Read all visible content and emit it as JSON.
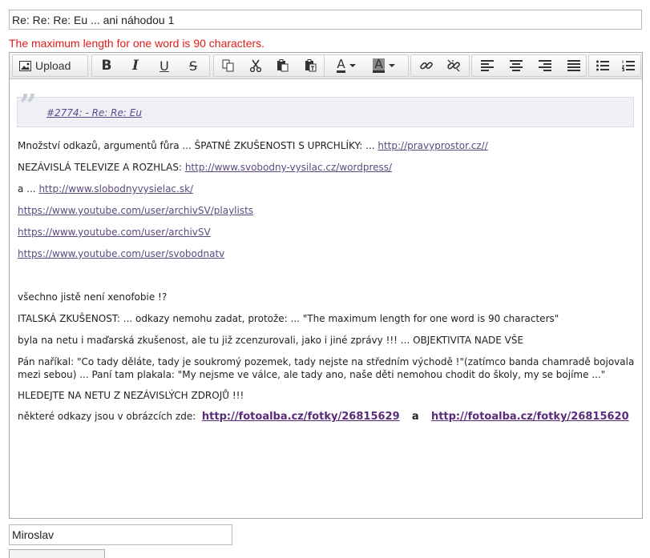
{
  "subject": {
    "value": "Re: Re: Re: Eu ... ani náhodou 1"
  },
  "error": {
    "text": "The maximum length for one word is 90 characters."
  },
  "toolbar": {
    "upload_label": "Upload",
    "bold_glyph": "B",
    "italic_glyph": "I",
    "underline_glyph": "U",
    "strike_glyph": "S",
    "text_color_glyph": "A",
    "bg_color_glyph": "A"
  },
  "content": {
    "quote_link": "#2774: - Re: Re: Eu",
    "line1_text": "Množství odkazů, argumentů fůra ... ŠPATNÉ ZKUŠENOSTI S UPRCHLÍKY: ... ",
    "line1_link": "http://pravyprostor.cz//",
    "line2_text": "NEZÁVISLÁ TELEVIZE A ROZHLAS: ",
    "line2_link": "http://www.svobodny-vysilac.cz/wordpress/",
    "line3_text": "a ... ",
    "line3_link": "http://www.slobodnyvysielac.sk/",
    "link4": "https://www.youtube.com/user/archivSV/playlists",
    "link5": "https://www.youtube.com/user/archivSV",
    "link6": "https://www.youtube.com/user/svobodnatv",
    "line7": "všechno jistě není xenofobie !?",
    "line8": "ITALSKÁ ZKUŠENOST: ... odkazy nemohu zadat, protože: ... \"The maximum length for one word is 90 characters\"",
    "line9": "byla na netu i maďarská zkušenost, ale tu již zcenzurovali, jako i jiné zprávy !!! ... OBJEKTIVITA NADE VŠE",
    "line10": "Pán naříkal: \"Co tady děláte, tady je soukromý pozemek, tady nejste na středním východě !\"(zatímco banda chamradě bojovala mezi sebou) ... Paní tam plakala: \"My nejsme ve válce, ale tady ano, naše děti nemohou chodit do školy, my se bojíme ...\"",
    "line11": "HLEDEJTE NA NETU Z NEZÁVISLÝCH ZDROJŮ !!!",
    "line12_text": "některé odkazy jsou v obrázcích zde:",
    "line12_link1": "http://fotoalba.cz/fotky/26815629",
    "line12_mid": "a",
    "line12_link2": "http://fotoalba.cz/fotky/26815620"
  },
  "name": {
    "value": "Miroslav"
  },
  "colors": {
    "error": "#e01b1b",
    "link": "#5a4a80",
    "quote_bg": "#eef0f6"
  }
}
